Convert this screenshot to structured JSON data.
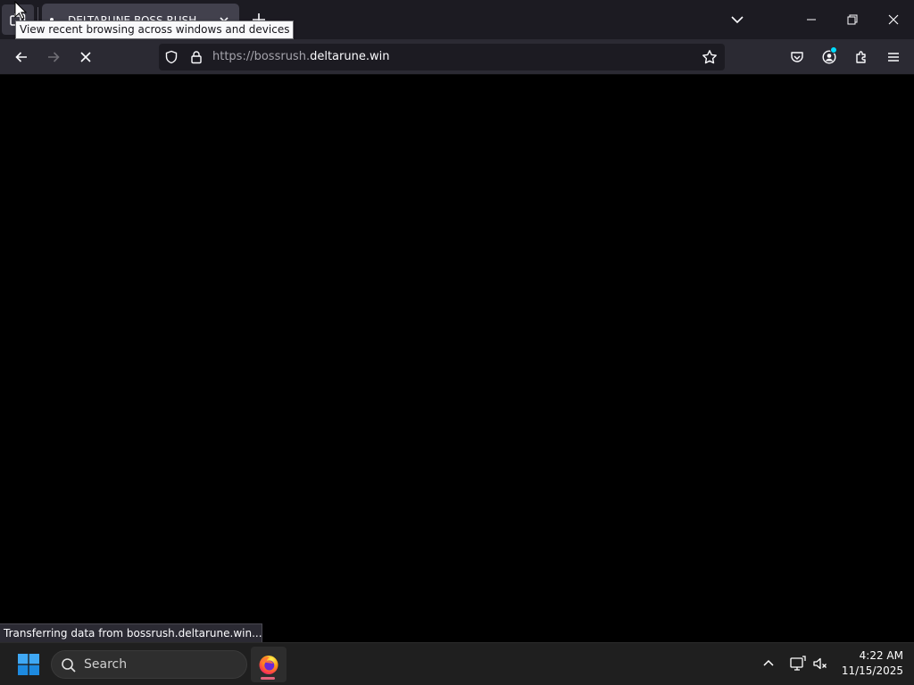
{
  "browser": {
    "tab": {
      "title": "DELTARUNE BOSS RUSH"
    },
    "tooltip": "View recent browsing across windows and devices",
    "url": {
      "scheme_prefix": "https://bossrush.",
      "domain": "deltarune.win"
    },
    "status": "Transferring data from bossrush.deltarune.win..."
  },
  "taskbar": {
    "search_label": "Search",
    "clock": {
      "time": "4:22 AM",
      "date": "11/15/2025"
    }
  },
  "colors": {
    "chrome_dark": "#1c1b22",
    "toolbar": "#2b2a33",
    "content": "#000000",
    "taskbar": "#1f1f1f",
    "firefox_indicator": "#e3637b",
    "account_badge": "#00ddff"
  },
  "icons": {
    "recent": "recent-browsing-icon",
    "back": "back-arrow-icon",
    "forward": "forward-arrow-icon",
    "stop": "stop-loading-icon",
    "shield": "tracking-protection-shield-icon",
    "lock": "lock-icon",
    "bookmark": "star-icon",
    "pocket": "pocket-icon",
    "account": "account-icon",
    "extensions": "puzzle-icon",
    "menu": "hamburger-menu-icon",
    "windows": "windows-logo-icon",
    "search": "search-icon",
    "firefox": "firefox-icon",
    "tray": "chevron-up-icon",
    "network": "network-icon",
    "volume": "volume-muted-icon"
  }
}
